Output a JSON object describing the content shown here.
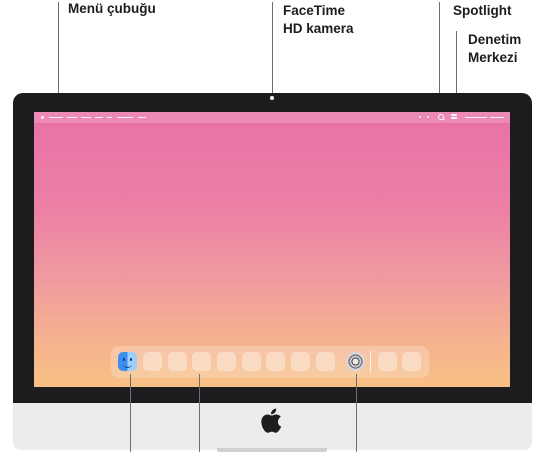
{
  "callouts": {
    "menu_bar": "Menü çubuğu",
    "camera_line1": "FaceTime",
    "camera_line2": "HD kamera",
    "spotlight": "Spotlight",
    "control_center_line1": "Denetim",
    "control_center_line2": "Merkezi"
  },
  "icons": {
    "finder": "finder-icon",
    "system_settings": "system-settings-icon",
    "brand": "apple-logo",
    "search": "magnifying-glass-icon",
    "control_center": "control-center-icon"
  },
  "colors": {
    "bezel": "#1c1c1e",
    "chin": "#ececed",
    "wallpaper_top": "#e871a6",
    "wallpaper_bottom": "#f8c084",
    "callout_text": "#1d1d1f",
    "leader_line": "#6e6e73"
  }
}
